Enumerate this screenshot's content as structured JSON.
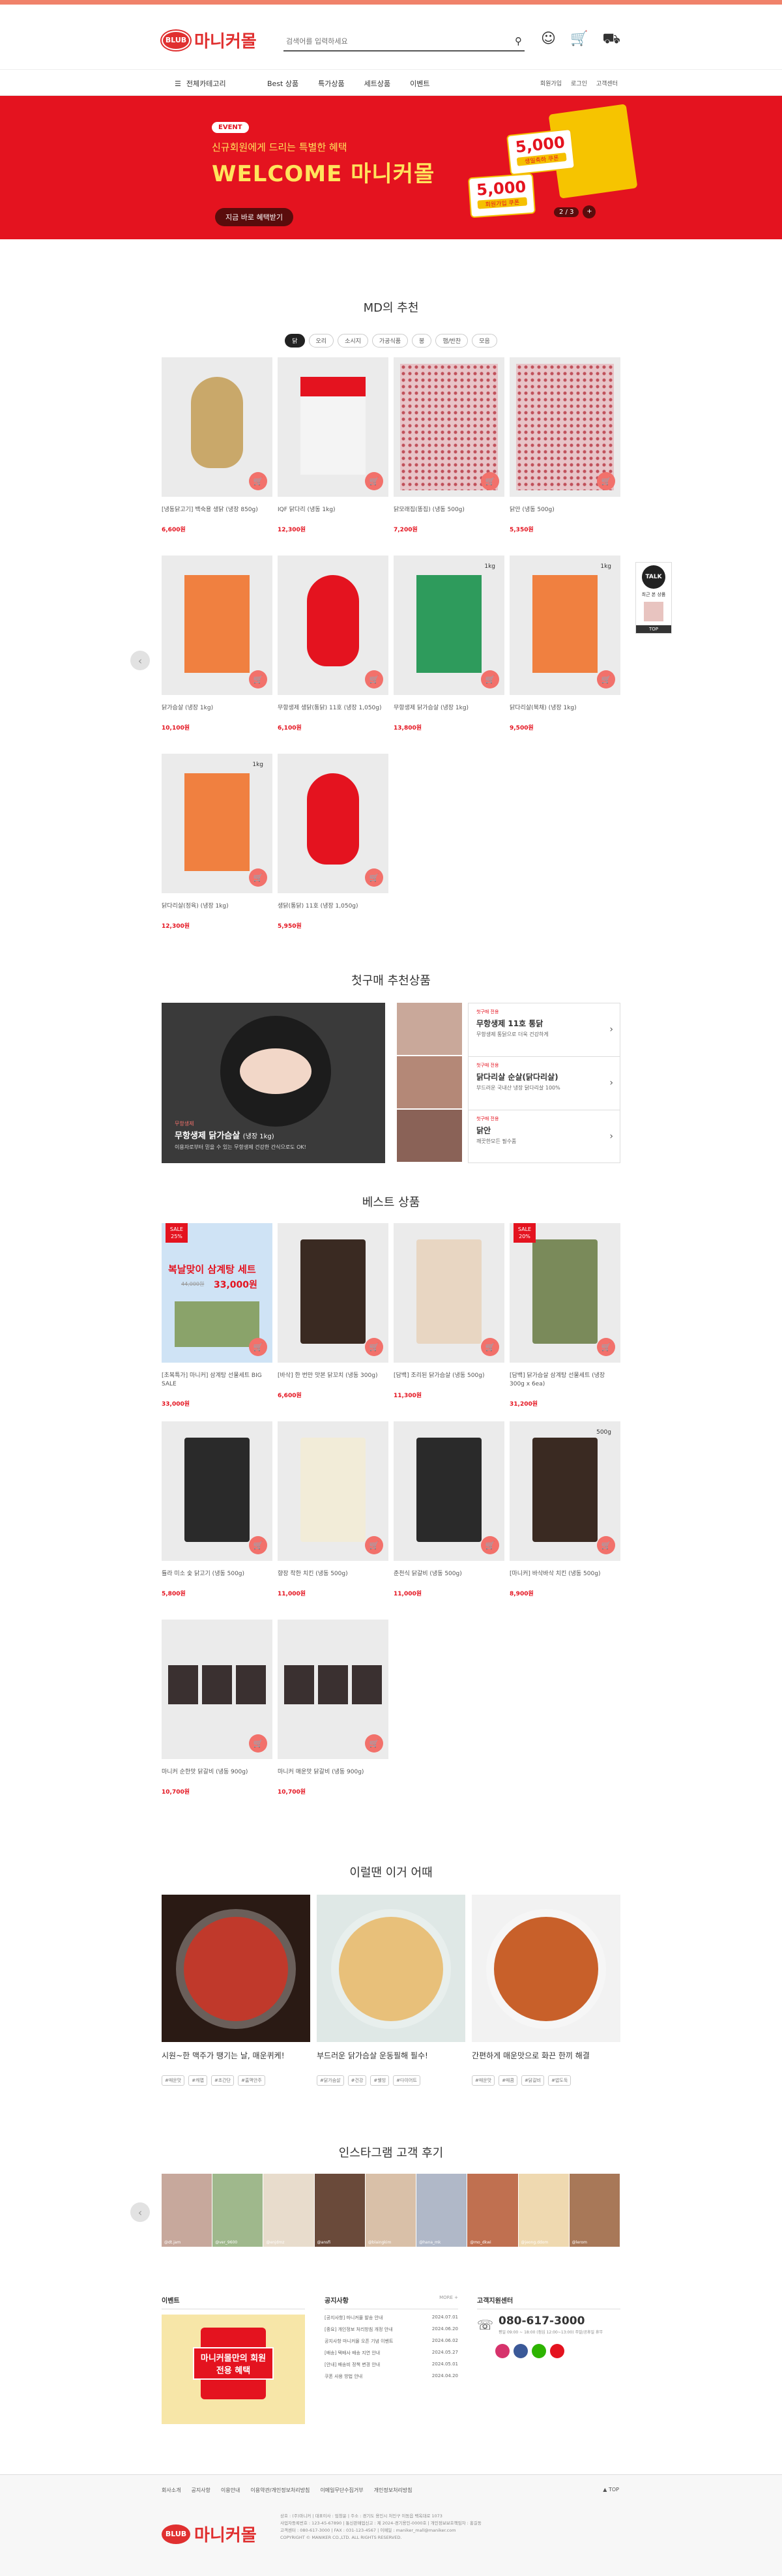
{
  "header": {
    "logo_badge": "BLUB",
    "logo_text": "마니커몰",
    "search_placeholder": "검색어를 입력하세요"
  },
  "nav": {
    "category": "전체카테고리",
    "menu": [
      "Best 상품",
      "특가상품",
      "세트상품",
      "이벤트"
    ],
    "right": [
      "회원가입",
      "로그인",
      "고객센터"
    ]
  },
  "banner": {
    "event": "EVENT",
    "sub": "신규회원에게 드리는 특별한 혜택",
    "title": "WELCOME 마니커몰",
    "cta": "지금 바로 혜택받기",
    "coupon1_value": "5,000",
    "coupon1_label": "생일축하 쿠폰",
    "coupon2_value": "5,000",
    "coupon2_label": "회원가입 쿠폰",
    "pager": "2 / 3"
  },
  "md": {
    "title": "MD의 추천",
    "chips": [
      "닭",
      "오리",
      "소시지",
      "가공식품",
      "봉",
      "햄/반찬",
      "모음"
    ],
    "products": [
      {
        "name": "[냉동닭고기] 백숙용 생닭 (냉장 850g)",
        "price": "6,600원"
      },
      {
        "name": "IQF 닭다리 (냉동 1kg)",
        "price": "12,300원"
      },
      {
        "name": "닭모래집(똥집) (냉동 500g)",
        "price": "7,200원"
      },
      {
        "name": "닭안 (냉동 500g)",
        "price": "5,350원"
      },
      {
        "name": "닭가슴살 (냉장 1kg)",
        "price": "10,100원"
      },
      {
        "name": "무항생제 생닭(통닭) 11호 (냉장 1,050g)",
        "price": "6,100원"
      },
      {
        "name": "무항생제 닭가슴살 (냉장 1kg)",
        "price": "13,800원"
      },
      {
        "name": "닭다리살(북채) (냉장 1kg)",
        "price": "9,500원"
      },
      {
        "name": "닭다리살(정육) (냉장 1kg)",
        "price": "12,300원"
      },
      {
        "name": "생닭(통닭) 11호 (냉장 1,050g)",
        "price": "5,950원"
      }
    ],
    "badge_1kg": "1kg"
  },
  "talk": {
    "label": "TALK",
    "text": "최근 본 상품",
    "top": "TOP"
  },
  "first": {
    "title": "첫구매 추천상품",
    "main_tag": "무항생제",
    "main_name": "무항생제 닭가슴살",
    "main_unit": "(냉장 1kg)",
    "main_desc": "이용자로부터 믿을 수 있는 무항생제 건강한 간식으로도 OK!",
    "items": [
      {
        "s": "첫구매 전용",
        "h": "무항생제 11호 통닭",
        "d": "무항생제 통닭으로 더욱 건강하게"
      },
      {
        "s": "첫구매 전용",
        "h": "닭다리살 순살(닭다리살)",
        "d": "부드러운 국내산 냉장 닭다리살 100%"
      },
      {
        "s": "첫구매 전용",
        "h": "닭안",
        "d": "깨끗한모든 필수품"
      }
    ]
  },
  "best": {
    "title": "베스트 상품",
    "sale1": "SALE 25%",
    "sale2": "SALE 20%",
    "set_title": "복날맞이 삼계탕 세트",
    "set_price": "33,000원",
    "set_old": "44,000원",
    "badge_500g": "500g",
    "products": [
      {
        "name": "[초복특가] 마니커] 삼계탕 선물세트 BIG SALE",
        "price": "33,000원"
      },
      {
        "name": "[바삭] 한 번만 맛본 닭꼬치 (냉동 300g)",
        "price": "6,600원"
      },
      {
        "name": "[담백] 조리된 닭가슴살 (냉동 500g)",
        "price": "11,300원"
      },
      {
        "name": "[담백] 닭가슴살 삼계탕 선물세트 (냉장 300g x 6ea)",
        "price": "31,200원"
      },
      {
        "name": "튤라 미소 숯 닭고기 (냉동 500g)",
        "price": "5,800원"
      },
      {
        "name": "향장 착한 치킨 (냉동 500g)",
        "price": "11,000원"
      },
      {
        "name": "춘천식 닭갈비 (냉동 500g)",
        "price": "11,000원"
      },
      {
        "name": "[마니커] 바삭바삭 치킨 (냉동 500g)",
        "price": "8,900원"
      },
      {
        "name": "마니커 순한맛 닭갈비 (냉동 900g)",
        "price": "10,700원"
      },
      {
        "name": "마니커 매운맛 닭갈비 (냉동 900g)",
        "price": "10,700원"
      }
    ]
  },
  "recipes": {
    "title": "이럴땐 이거 어때",
    "items": [
      {
        "t": "시원~한 맥주가 땡기는 날, 매운퀴케!",
        "tags": [
          "#매운맛",
          "#캐맵",
          "#초간단",
          "#홈맥안주"
        ]
      },
      {
        "t": "부드러운 닭가슴살 운동필해 필수!",
        "tags": [
          "#닭가슴살",
          "#건강",
          "#웰빙",
          "#다이어트"
        ]
      },
      {
        "t": "간편하게 매운맛으로 화끈 한끼 해결",
        "tags": [
          "#매운맛",
          "#매콤",
          "#닭갈비",
          "#밥도둑"
        ]
      }
    ]
  },
  "insta": {
    "title": "인스타그램 고객 후기",
    "users": [
      "@dt.jam",
      "@ver_9600",
      "@enjdmz",
      "@ansfi",
      "@blaingkim",
      "@hana_mk",
      "@mo_dkwi",
      "@jeong.ddom",
      "@lerom"
    ]
  },
  "footinfo": {
    "event_title": "이벤트",
    "event_text": "마니커몰만의 회원 전용 혜택",
    "notice_title": "공지사항",
    "notice_more": "MORE +",
    "notices": [
      {
        "t": "[공지사항] 마니커몰 발송 안내",
        "d": "2024.07.01"
      },
      {
        "t": "[중요] 개인정보 처리방침 개정 안내",
        "d": "2024.06.20"
      },
      {
        "t": "공지사항 마니커몰 오픈 기념 이벤트",
        "d": "2024.06.02"
      },
      {
        "t": "[배송] 택배사 배송 지연 안내",
        "d": "2024.05.27"
      },
      {
        "t": "[안내] 배송비 정책 변경 안내",
        "d": "2024.05.01"
      },
      {
        "t": "쿠폰 사용 방법 안내",
        "d": "2024.04.20"
      }
    ],
    "cs_title": "고객지원센터",
    "phone": "080-617-3000",
    "hours": "평일 09:00 ~ 18:00 (점심 12:00~13:00) 주말/공휴일 휴무"
  },
  "footer": {
    "links": [
      "회사소개",
      "공지사항",
      "이용안내",
      "이용약관/개인정보처리방침",
      "이메일무단수집거부",
      "개인정보처리방침"
    ],
    "top": "▲ TOP",
    "logo_text": "마니커몰",
    "info": [
      "상호 : (주)마니커 | 대표이사 : 임창윤 | 주소 : 경기도 용인시 처인구 이동읍 백옥대로 1073",
      "사업자등록번호 : 123-45-67890 | 통신판매업신고 : 제 2024-경기용인-0000호 | 개인정보보호책임자 : 홍길동",
      "고객센터 : 080-617-3000 | FAX : 031-123-4567 | 이메일 : maniker_mall@maniker.com",
      "COPYRIGHT © MANIKER CO.,LTD. ALL RIGHTS RESERVED."
    ]
  }
}
